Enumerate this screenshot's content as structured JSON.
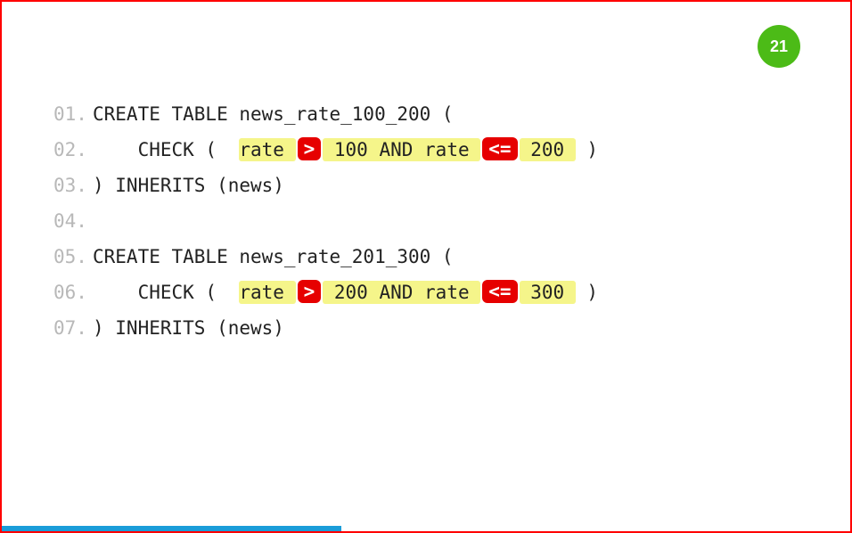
{
  "page_number": "21",
  "progress_percent": 40,
  "code_lines": [
    {
      "n": "01",
      "segments": [
        {
          "t": "text",
          "v": "CREATE TABLE news_rate_100_200 ("
        }
      ]
    },
    {
      "n": "02",
      "segments": [
        {
          "t": "text",
          "v": "    CHECK (  "
        },
        {
          "t": "hl",
          "v": "rate "
        },
        {
          "t": "op",
          "v": ">"
        },
        {
          "t": "hl",
          "v": " 100 AND rate "
        },
        {
          "t": "op",
          "v": "<="
        },
        {
          "t": "hl",
          "v": " 200 "
        },
        {
          "t": "text",
          "v": " )"
        }
      ]
    },
    {
      "n": "03",
      "segments": [
        {
          "t": "text",
          "v": ") INHERITS (news)"
        }
      ]
    },
    {
      "n": "04",
      "segments": []
    },
    {
      "n": "05",
      "segments": [
        {
          "t": "text",
          "v": "CREATE TABLE news_rate_201_300 ("
        }
      ]
    },
    {
      "n": "06",
      "segments": [
        {
          "t": "text",
          "v": "    CHECK (  "
        },
        {
          "t": "hl",
          "v": "rate "
        },
        {
          "t": "op",
          "v": ">"
        },
        {
          "t": "hl",
          "v": " 200 AND rate "
        },
        {
          "t": "op",
          "v": "<="
        },
        {
          "t": "hl",
          "v": " 300 "
        },
        {
          "t": "text",
          "v": " )"
        }
      ]
    },
    {
      "n": "07",
      "segments": [
        {
          "t": "text",
          "v": ") INHERITS (news)"
        }
      ]
    }
  ]
}
